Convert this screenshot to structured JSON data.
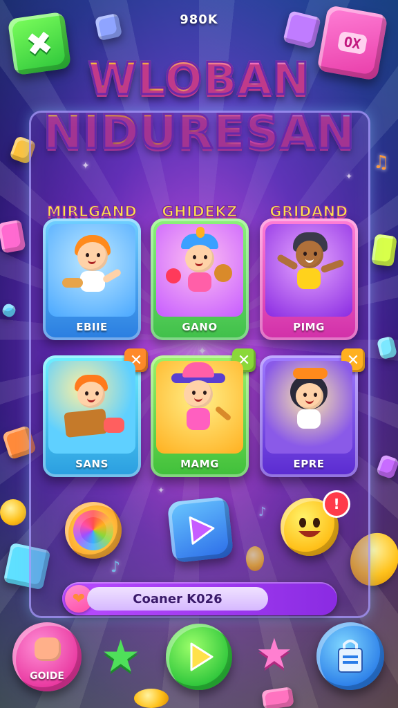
{
  "header": {
    "top_label": "980K"
  },
  "corner_buttons": {
    "left_icon": "close-x-icon",
    "right_label": "OX"
  },
  "title": {
    "line1": "WLOBAN",
    "line2": "NIDURESAN"
  },
  "cards": [
    {
      "header": "MIRLGAND",
      "name": "EBIIE",
      "theme": "#4aa8ff",
      "badge": ""
    },
    {
      "header": "GHIDEKZ",
      "name": "GANO",
      "theme": "#c65cff",
      "badge": ""
    },
    {
      "header": "GRIDAND",
      "name": "PIMG",
      "theme": "#b43ee8",
      "badge": ""
    },
    {
      "header": "",
      "name": "SANS",
      "theme": "#3ad0ff",
      "badge": "✕"
    },
    {
      "header": "",
      "name": "MAMG",
      "theme": "#ffb020",
      "badge": "✕"
    },
    {
      "header": "",
      "name": "EPRE",
      "theme": "#7a46e0",
      "badge": "✕"
    }
  ],
  "middle_row": {
    "left_icon": "color-wheel-icon",
    "center_icon": "play-icon",
    "right_icon": "smiley-face-icon",
    "right_badge": "!"
  },
  "score_bar": {
    "label": "Coaner K026"
  },
  "bottom_bar": {
    "guide_label": "GOIDE",
    "play_icon": "play-icon",
    "shop_icon": "shopping-bag-icon"
  },
  "colors": {
    "accent_yellow": "#ffe14a",
    "accent_pink": "#ff4fa8",
    "accent_green": "#2bc43a",
    "accent_blue": "#2a8cff"
  }
}
